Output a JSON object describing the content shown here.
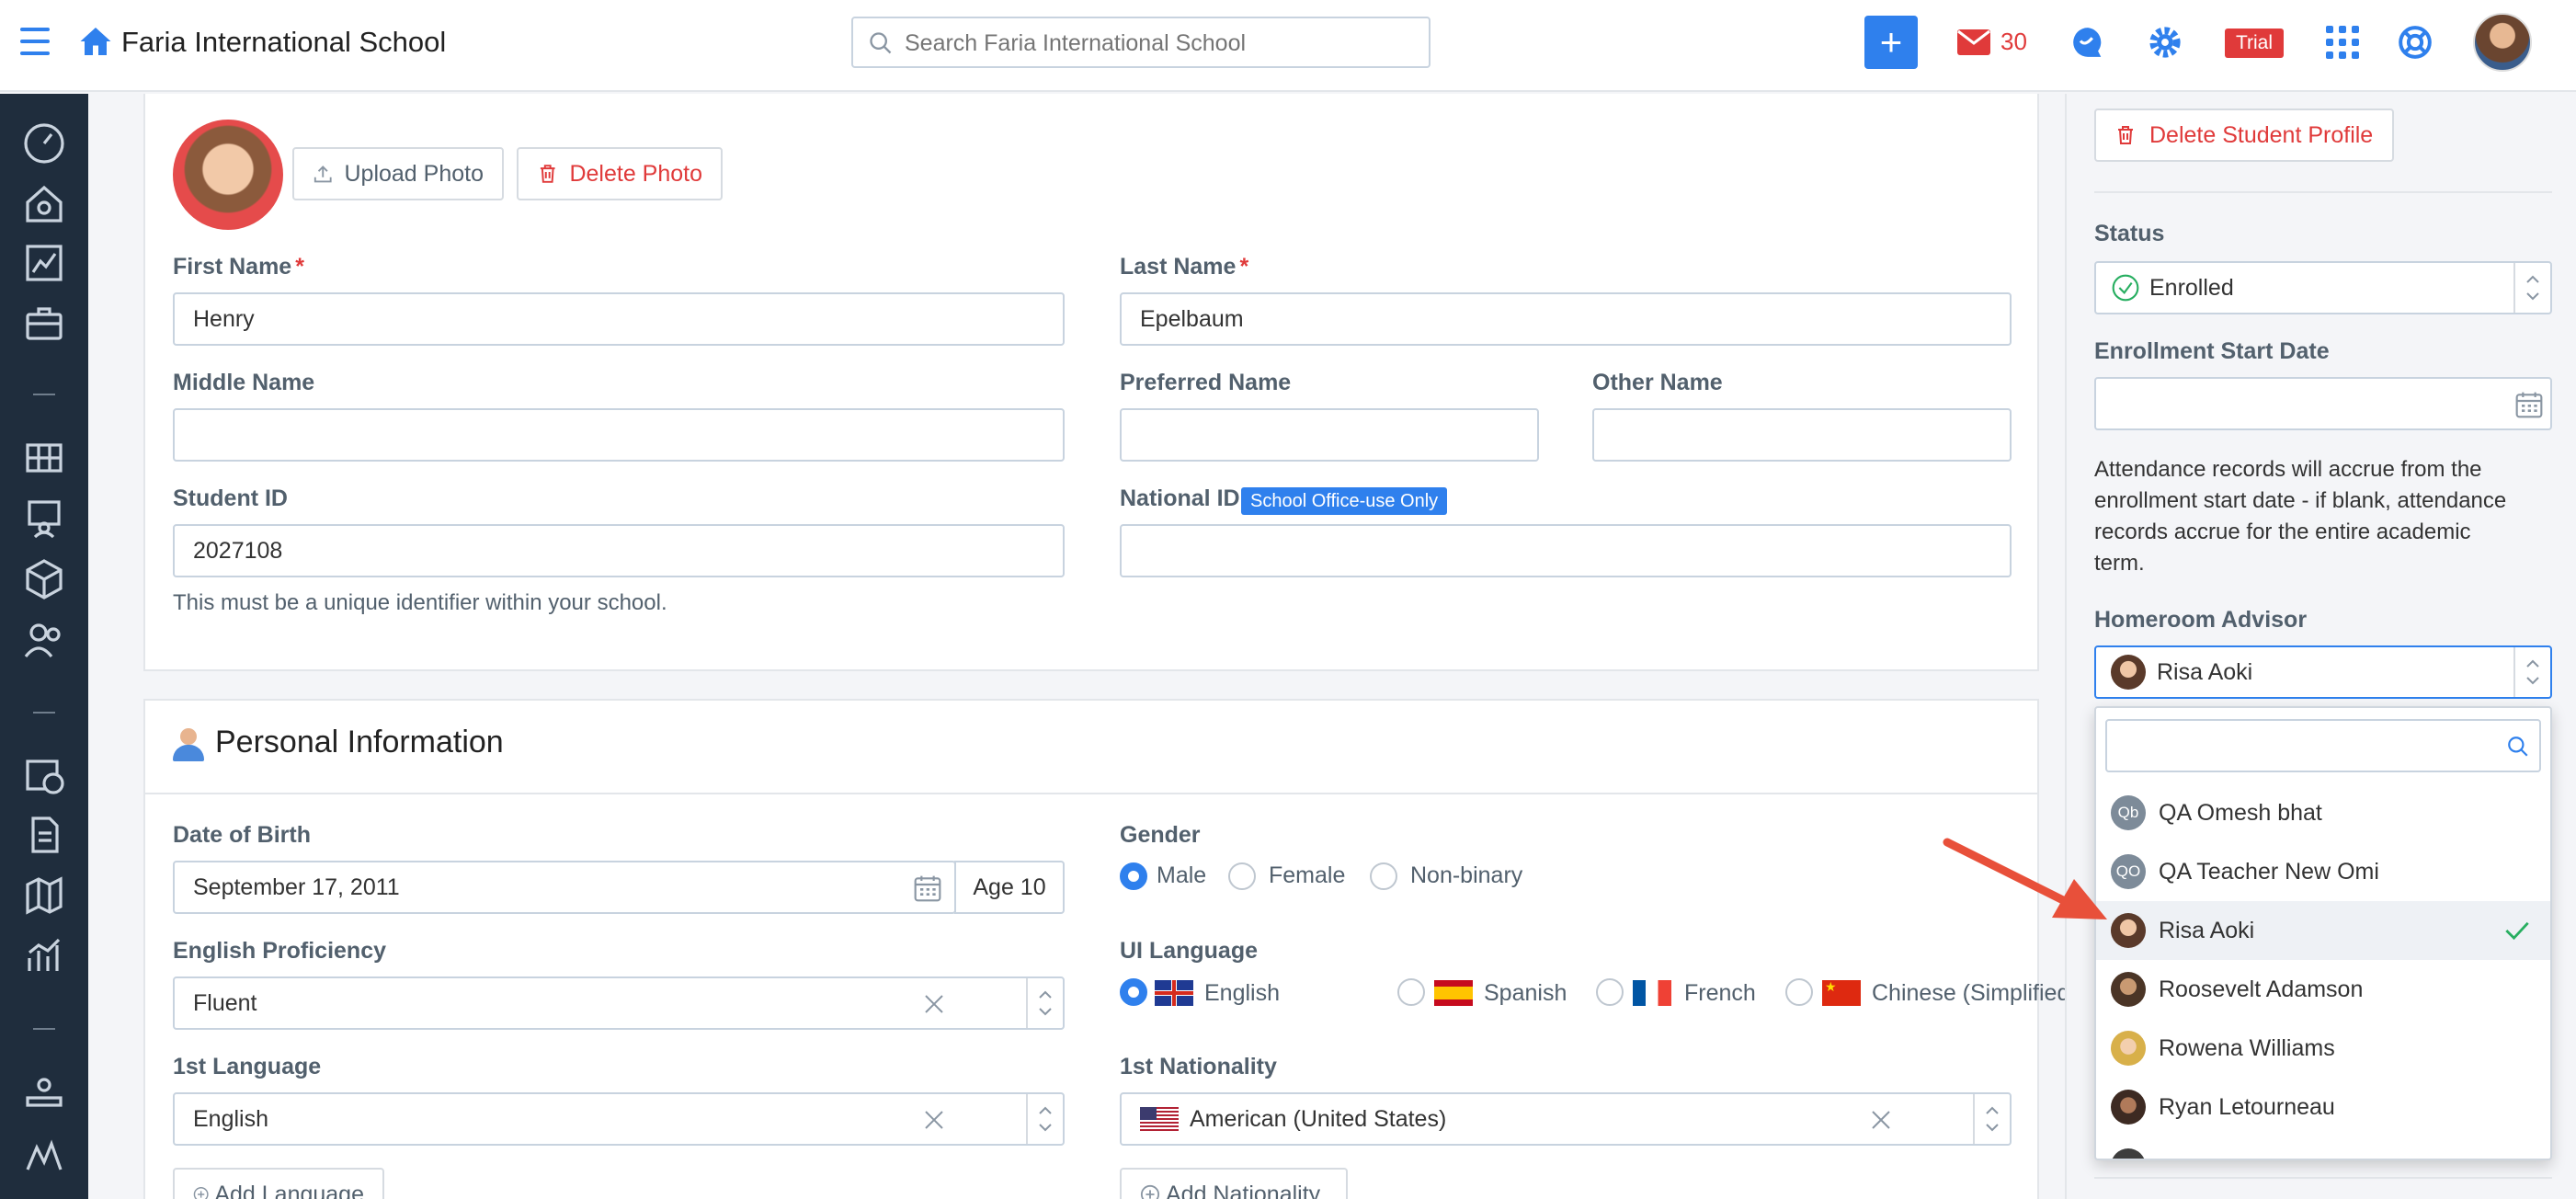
{
  "header": {
    "school_name": "Faria International School",
    "search_placeholder": "Search Faria International School",
    "mail_count": "30",
    "trial_badge": "Trial"
  },
  "photo": {
    "upload_label": "Upload Photo",
    "delete_label": "Delete Photo"
  },
  "form": {
    "first_name_label": "First Name",
    "first_name_value": "Henry",
    "last_name_label": "Last Name",
    "last_name_value": "Epelbaum",
    "required_mark": "*",
    "middle_name_label": "Middle Name",
    "preferred_name_label": "Preferred Name",
    "other_name_label": "Other Name",
    "student_id_label": "Student ID",
    "student_id_value": "2027108",
    "student_id_help": "This must be a unique identifier within your school.",
    "national_id_label": "National ID",
    "office_badge": "School Office-use Only"
  },
  "personal": {
    "section_title": "Personal Information",
    "dob_label": "Date of Birth",
    "dob_value": "September 17, 2011",
    "age_value": "Age 10",
    "gender_label": "Gender",
    "gender_options": [
      "Male",
      "Female",
      "Non-binary"
    ],
    "gender_selected": "Male",
    "english_label": "English Proficiency",
    "english_value": "Fluent",
    "ui_language_label": "UI Language",
    "ui_languages": [
      "English",
      "Spanish",
      "French",
      "Chinese (Simplified)"
    ],
    "ui_language_selected": "English",
    "first_language_label": "1st Language",
    "first_language_value": "English",
    "nationality_label": "1st Nationality",
    "nationality_value": "American (United States)",
    "add_language": "Add Language",
    "add_nationality": "Add Nationality"
  },
  "sidebar_right": {
    "delete_profile": "Delete Student Profile",
    "status_label": "Status",
    "status_value": "Enrolled",
    "enroll_start_label": "Enrollment Start Date",
    "attendance_note_lines": [
      "Attendance records will accrue from the",
      "enrollment start date - if blank, attendance",
      "records accrue for the entire academic",
      "term."
    ],
    "homeroom_label": "Homeroom Advisor",
    "homeroom_value": "Risa Aoki"
  },
  "dropdown": {
    "options": [
      {
        "initials": "Qb",
        "name": "QA Omesh bhat",
        "selected": false
      },
      {
        "initials": "QO",
        "name": "QA Teacher New Omi",
        "selected": false
      },
      {
        "initials": "",
        "name": "Risa Aoki",
        "selected": true
      },
      {
        "initials": "",
        "name": "Roosevelt Adamson",
        "selected": false
      },
      {
        "initials": "",
        "name": "Rowena Williams",
        "selected": false
      },
      {
        "initials": "",
        "name": "Ryan Letourneau",
        "selected": false
      }
    ]
  },
  "colors": {
    "primary": "#2f80ed",
    "danger": "#e03a3a",
    "sidebar": "#1f2d3d",
    "annotation_arrow": "#e8503a"
  }
}
